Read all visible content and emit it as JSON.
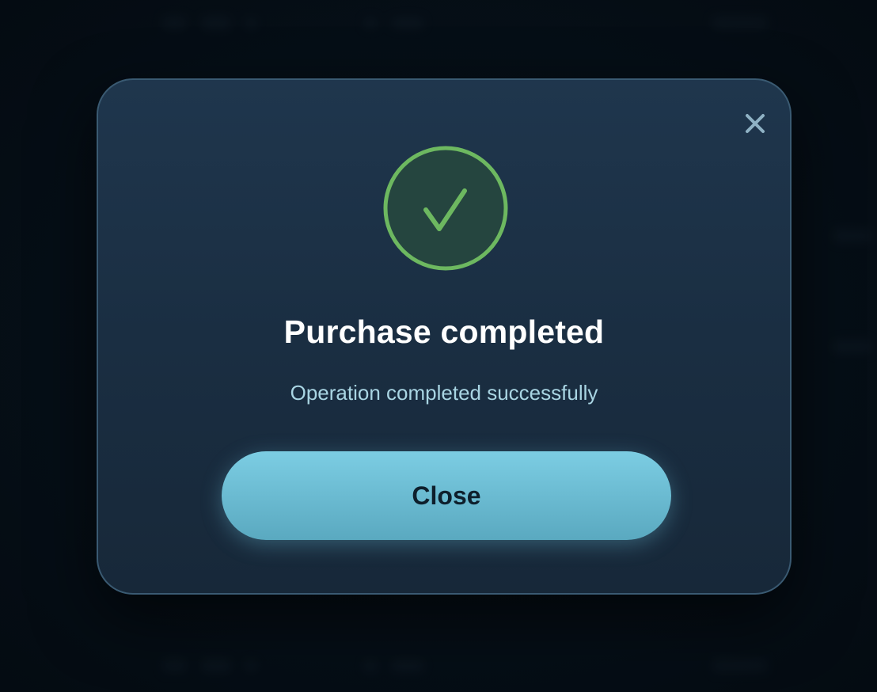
{
  "dialog": {
    "title": "Purchase completed",
    "message": "Operation completed successfully",
    "close_button_label": "Close",
    "close_icon": "close-icon",
    "status_icon": "checkmark-icon"
  },
  "colors": {
    "modal_background": "#1c3247",
    "modal_border": "#3a5a72",
    "success_green": "#6db860",
    "button_accent": "#6bbdd4",
    "subtitle_text": "#a9d5e3"
  }
}
